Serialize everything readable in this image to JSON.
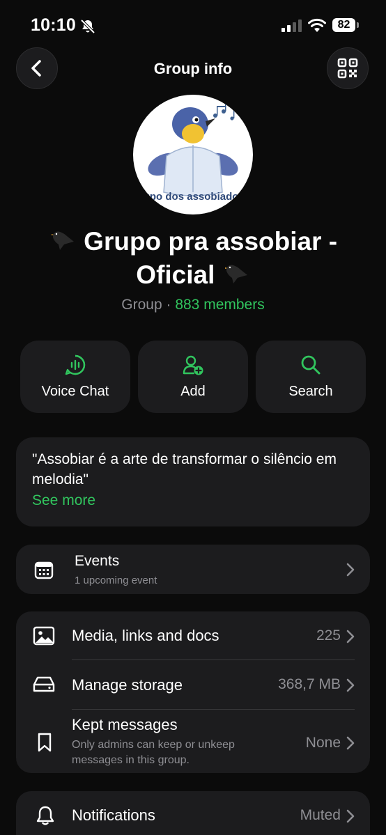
{
  "status": {
    "time": "10:10",
    "battery": "82"
  },
  "header": {
    "title": "Group info"
  },
  "avatar": {
    "caption": "upo dos assobiador"
  },
  "group": {
    "name_line1": "Grupo pra assobiar -",
    "name_line2": "Oficial",
    "type": "Group",
    "separator": " · ",
    "members": "883 members"
  },
  "actions": [
    {
      "label": "Voice Chat",
      "icon": "voice-chat-icon"
    },
    {
      "label": "Add",
      "icon": "add-user-icon"
    },
    {
      "label": "Search",
      "icon": "search-icon"
    }
  ],
  "description": {
    "text": "\"Assobiar é a arte de transformar o silêncio em melodia\"",
    "see_more": "See more"
  },
  "events": {
    "title": "Events",
    "subtitle": "1 upcoming event"
  },
  "media_section": {
    "media": {
      "label": "Media, links and docs",
      "value": "225"
    },
    "storage": {
      "label": "Manage storage",
      "value": "368,7 MB"
    },
    "kept": {
      "label": "Kept messages",
      "subtitle": "Only admins can keep or unkeep messages in this group.",
      "value": "None"
    }
  },
  "notifications": {
    "label": "Notifications",
    "value": "Muted"
  },
  "colors": {
    "accent": "#31c55e",
    "card": "#1c1c1e",
    "background": "#0b0b0b",
    "secondary_text": "#8e8e93"
  }
}
